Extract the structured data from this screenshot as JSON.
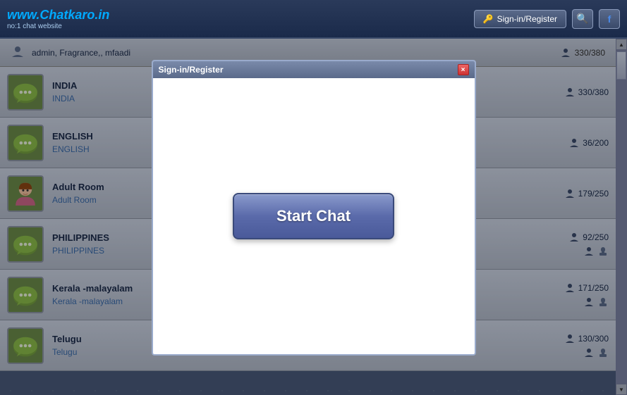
{
  "header": {
    "logo_main": "www.Chatkaro.in",
    "logo_sub": "no:1 chat website",
    "signin_label": "Sign-in/Register",
    "search_icon": "🔍",
    "facebook_icon": "f"
  },
  "topbar": {
    "admin_label": "admin, Fragrance,, mfaadi",
    "count_label": "330/380"
  },
  "rooms": [
    {
      "name": "INDIA",
      "tag": "INDIA",
      "count": "330/380",
      "has_sub_icons": false,
      "avatar_type": "chat"
    },
    {
      "name": "ENGLISH",
      "tag": "ENGLISH",
      "count": "36/200",
      "has_sub_icons": false,
      "avatar_type": "chat"
    },
    {
      "name": "Adult Room",
      "tag": "Adult Room",
      "count": "179/250",
      "has_sub_icons": false,
      "avatar_type": "girl"
    },
    {
      "name": "PHILIPPINES",
      "tag": "PHILIPPINES",
      "count": "92/250",
      "has_sub_icons": true,
      "avatar_type": "chat"
    },
    {
      "name": "Kerala -malayalam",
      "tag": "Kerala -malayalam",
      "count": "171/250",
      "has_sub_icons": true,
      "avatar_type": "chat"
    },
    {
      "name": "Telugu",
      "tag": "Telugu",
      "count": "130/300",
      "has_sub_icons": true,
      "avatar_type": "chat"
    }
  ],
  "modal": {
    "title": "Sign-in/Register",
    "close_label": "×",
    "start_chat_label": "Start Chat"
  }
}
